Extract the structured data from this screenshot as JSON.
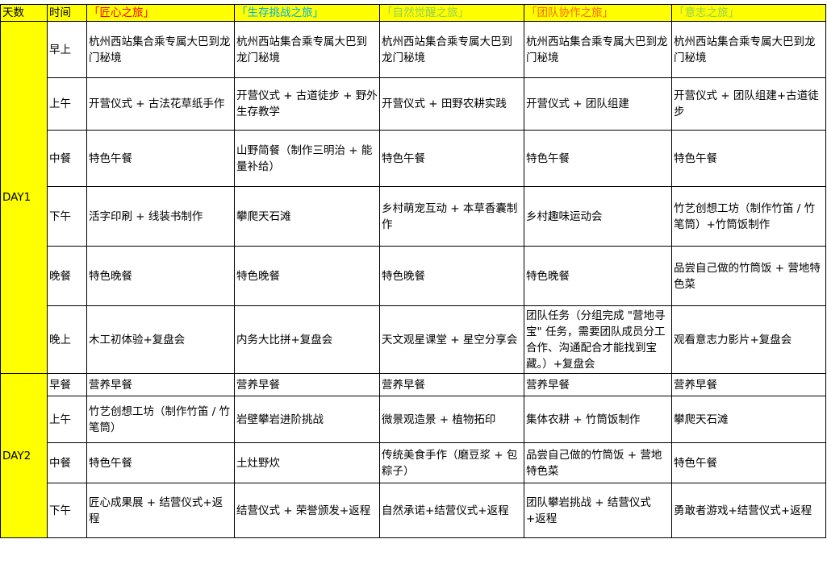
{
  "table": {
    "header": {
      "day_col": "天数",
      "time_col": "时间",
      "routes": [
        "「匠心之旅」",
        "「生存挑战之旅」",
        "「自然觉醒之旅」",
        "「团队协作之旅」",
        "「意志之旅」"
      ]
    },
    "days": [
      {
        "label": "DAY1",
        "rows": [
          {
            "time": "早上",
            "cells": [
              "杭州西站集合乘专属大巴到龙门秘境",
              "杭州西站集合乘专属大巴到龙门秘境",
              "杭州西站集合乘专属大巴到龙门秘境",
              "杭州西站集合乘专属大巴到龙门秘境",
              "杭州西站集合乘专属大巴到龙门秘境"
            ]
          },
          {
            "time": "上午",
            "cells": [
              "开营仪式 + 古法花草纸手作",
              "开营仪式 + 古道徒步 + 野外生存教学",
              "开营仪式 + 田野农耕实践",
              "开营仪式 + 团队组建",
              "开营仪式 + 团队组建+古道徒步"
            ]
          },
          {
            "time": "中餐",
            "cells": [
              "特色午餐",
              "山野简餐（制作三明治 + 能量补给）",
              "特色午餐",
              "特色午餐",
              "特色午餐"
            ]
          },
          {
            "time": "下午",
            "cells": [
              "活字印刷 + 线装书制作",
              "攀爬天石滩",
              "乡村萌宠互动 + 本草香囊制作",
              "乡村趣味运动会",
              "竹艺创想工坊（制作竹笛 / 竹笔筒）+竹筒饭制作"
            ]
          },
          {
            "time": "晚餐",
            "cells": [
              "特色晚餐",
              "特色晚餐",
              "特色晚餐",
              "特色晚餐",
              "品尝自己做的竹筒饭 + 营地特色菜"
            ]
          },
          {
            "time": "晚上",
            "cells": [
              "木工初体验+复盘会",
              "内务大比拼+复盘会",
              "天文观星课堂 + 星空分享会",
              "团队任务（分组完成 \"营地寻宝\" 任务，需要团队成员分工合作、沟通配合才能找到宝藏。）+复盘会",
              "观看意志力影片+复盘会"
            ]
          }
        ]
      },
      {
        "label": "DAY2",
        "rows": [
          {
            "time": "早餐",
            "cells": [
              "营养早餐",
              "营养早餐",
              "营养早餐",
              "营养早餐",
              "营养早餐"
            ]
          },
          {
            "time": "上午",
            "cells": [
              "竹艺创想工坊（制作竹笛 / 竹笔筒）",
              "岩壁攀岩进阶挑战",
              "微景观造景 + 植物拓印",
              "集体农耕 + 竹筒饭制作",
              "攀爬天石滩"
            ]
          },
          {
            "time": "中餐",
            "cells": [
              "特色午餐",
              "土灶野炊",
              "传统美食手作（磨豆浆 + 包粽子）",
              "品尝自己做的竹筒饭 + 营地特色菜",
              "特色午餐"
            ]
          },
          {
            "time": "下午",
            "cells": [
              "匠心成果展 + 结营仪式+返程",
              "结营仪式 + 荣誉颁发+返程",
              "自然承诺+结营仪式+返程",
              "团队攀岩挑战 + 结营仪式+返程",
              "勇敢者游戏+结营仪式+返程"
            ]
          }
        ]
      }
    ]
  }
}
